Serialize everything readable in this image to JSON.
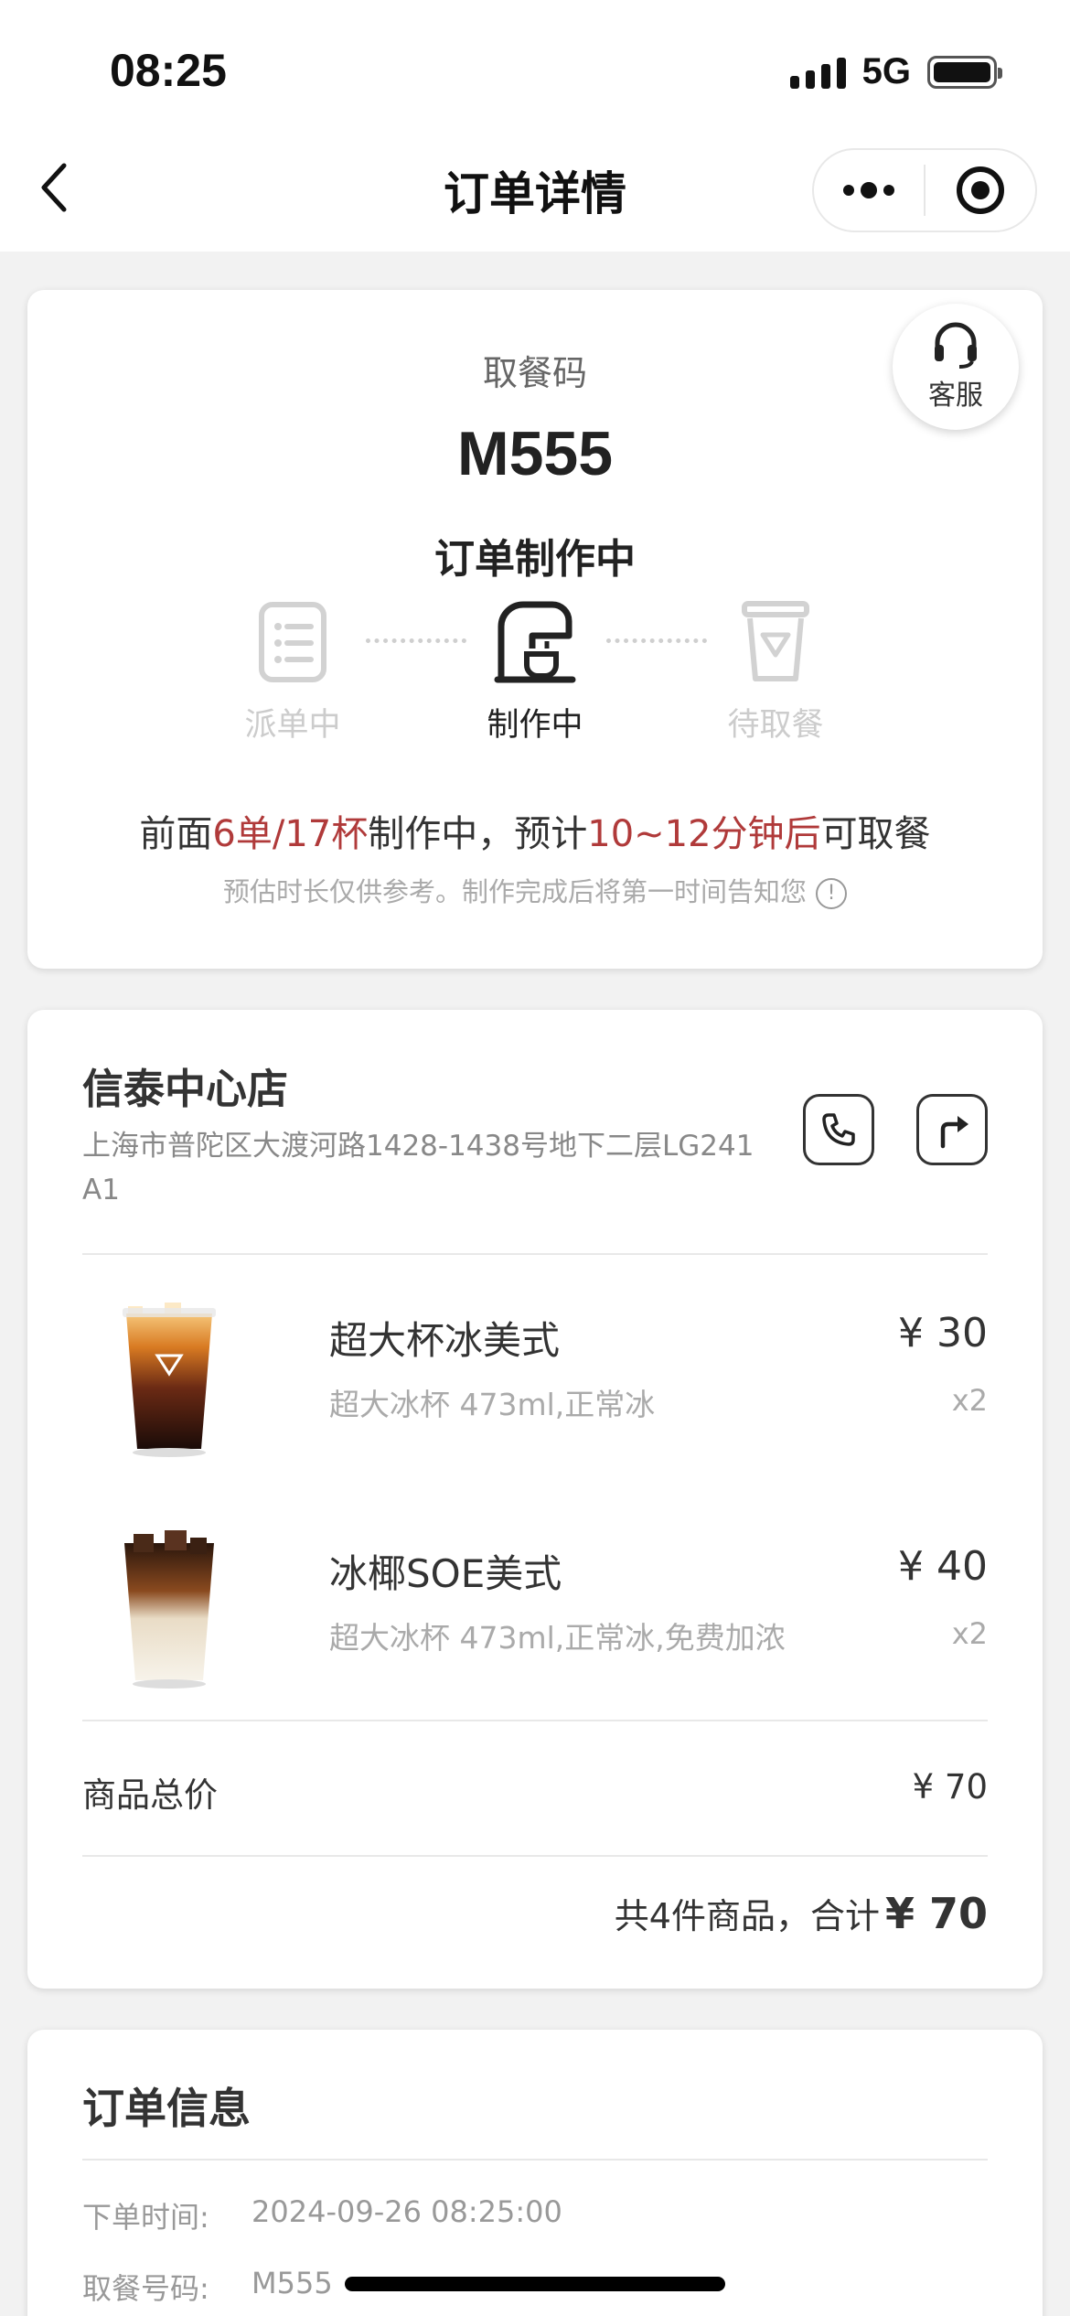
{
  "status_bar": {
    "time": "08:25",
    "network": "5G"
  },
  "nav": {
    "title": "订单详情"
  },
  "pickup": {
    "service_label": "客服",
    "label": "取餐码",
    "code": "M555",
    "status": "订单制作中",
    "steps": [
      {
        "label": "派单中",
        "state": "done"
      },
      {
        "label": "制作中",
        "state": "active"
      },
      {
        "label": "待取餐",
        "state": "pending"
      }
    ],
    "queue": {
      "prefix": "前面",
      "orders": "6单/17杯",
      "middle": "制作中，预计",
      "eta": "10~12分钟后",
      "suffix": "可取餐"
    },
    "hint": "预估时长仅供参考。制作完成后将第一时间告知您",
    "accent_color": "#b03a3a"
  },
  "store": {
    "name": "信泰中心店",
    "address": "上海市普陀区大渡河路1428-1438号地下二层LG241 A1",
    "items": [
      {
        "name": "超大杯冰美式",
        "spec": "超大冰杯 473ml,正常冰",
        "price": "¥ 30",
        "qty": "x2"
      },
      {
        "name": "冰椰SOE美式",
        "spec": "超大冰杯 473ml,正常冰,免费加浓",
        "price": "¥ 40",
        "qty": "x2"
      }
    ],
    "subtotal_label": "商品总价",
    "subtotal_value": "¥ 70",
    "total_prefix": "共4件商品，合计",
    "total_amount": "¥ 70"
  },
  "order_info": {
    "title": "订单信息",
    "rows": [
      {
        "label": "下单时间:",
        "value": "2024-09-26 08:25:00"
      },
      {
        "label": "取餐号码:",
        "value": "M555"
      }
    ]
  }
}
